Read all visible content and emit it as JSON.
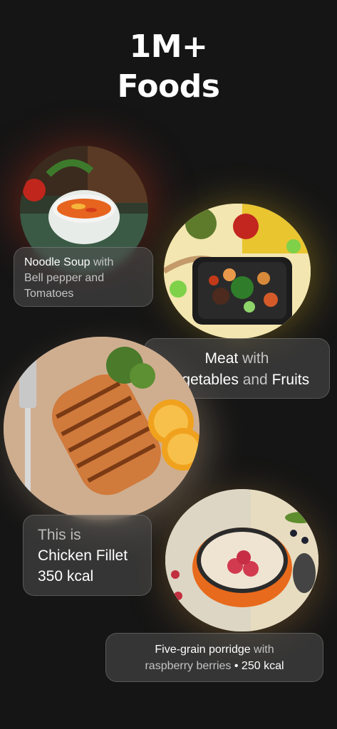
{
  "headline": {
    "line1": "1M+",
    "line2": "Foods"
  },
  "cards": {
    "noodle": {
      "name": "Noodle Soup",
      "with": "with",
      "line2": "Bell pepper and",
      "line3": "Tomatoes"
    },
    "meat": {
      "name": "Meat",
      "with": "with",
      "part2": "Vegetables",
      "and": "and",
      "part3": "Fruits"
    },
    "chicken": {
      "line1": "This is",
      "line2": "Chicken Fillet",
      "line3": "350 kcal"
    },
    "porridge": {
      "name": "Five-grain porridge",
      "with": "with",
      "line2a": "raspberry berries",
      "dot": "•",
      "kcal": "250 kcal"
    }
  },
  "colors": {
    "background": "#151515",
    "glow_red": "#9a2a1c",
    "glow_yellow": "#c9a21a",
    "glow_peach": "#f1c8a0"
  },
  "images": [
    "noodle-soup-photo",
    "meat-vegetables-photo",
    "chicken-fillet-photo",
    "porridge-photo"
  ]
}
